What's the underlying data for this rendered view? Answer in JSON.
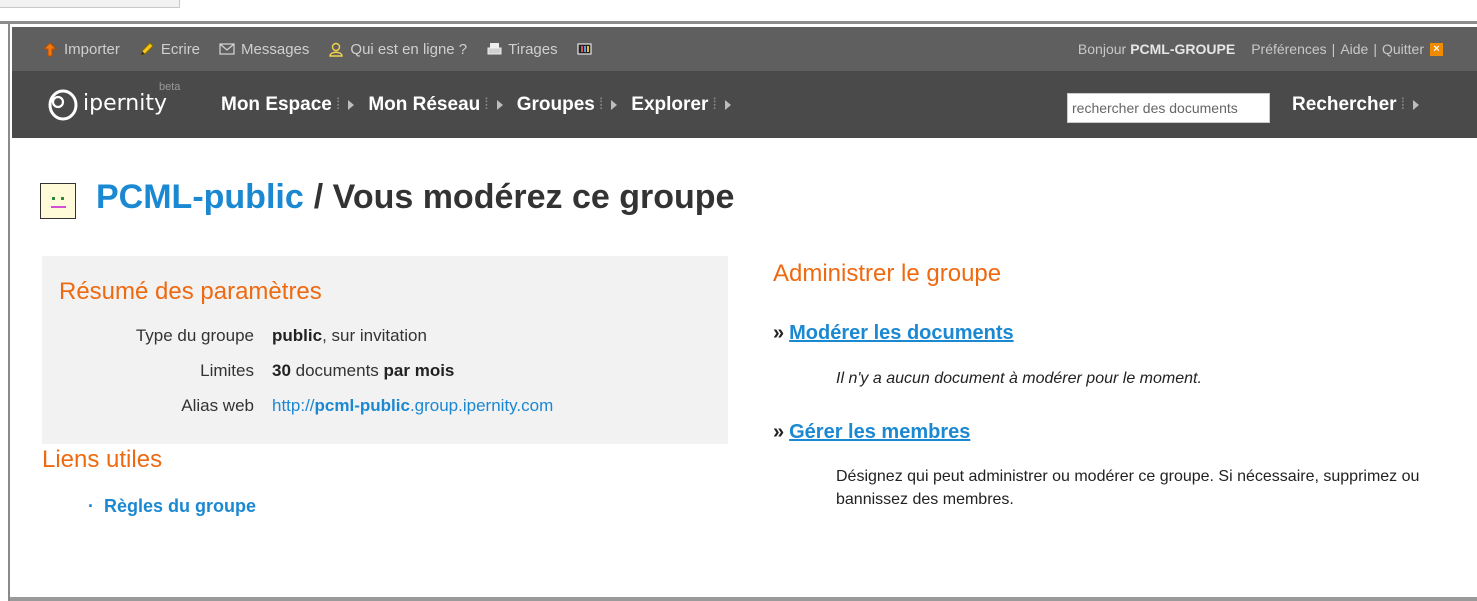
{
  "topbar": {
    "items": [
      {
        "label": "Importer",
        "icon": "upload-arrow-icon"
      },
      {
        "label": "Ecrire",
        "icon": "pencil-icon"
      },
      {
        "label": "Messages",
        "icon": "envelope-icon"
      },
      {
        "label": "Qui est en ligne ?",
        "icon": "user-icon"
      },
      {
        "label": "Tirages",
        "icon": "printer-icon"
      },
      {
        "label": "",
        "icon": "film-icon"
      }
    ],
    "greeting": "Bonjour",
    "username": "PCML-GROUPE",
    "preferences": "Préférences",
    "help": "Aide",
    "quit": "Quitter",
    "separator": "|"
  },
  "navbar": {
    "logo_text": "ipernity",
    "logo_badge": "beta",
    "menu": [
      {
        "label": "Mon Espace"
      },
      {
        "label": "Mon Réseau"
      },
      {
        "label": "Groupes"
      },
      {
        "label": "Explorer"
      }
    ],
    "search_placeholder": "rechercher des documents",
    "search_button": "Rechercher",
    "dotted_separator": "⁞"
  },
  "page": {
    "group_name": "PCML-public",
    "title_suffix": "/ Vous modérez ce groupe"
  },
  "settings": {
    "heading": "Résumé des paramètres",
    "type_label": "Type du groupe",
    "type_value_bold": "public",
    "type_value_rest": ", sur invitation",
    "limits_label": "Limites",
    "limits_count": "30",
    "limits_middle": " documents ",
    "limits_period": "par mois",
    "alias_label": "Alias web",
    "alias_prefix": "http://",
    "alias_bold": "pcml-public",
    "alias_suffix": ".group.ipernity.com"
  },
  "useful_links": {
    "heading": "Liens utiles",
    "bullet": "·",
    "items": [
      {
        "label": "Règles du groupe"
      }
    ]
  },
  "admin": {
    "heading": "Administrer le groupe",
    "marker": "»",
    "actions": [
      {
        "label": "Modérer les documents",
        "description": "Il n'y a aucun document à modérer pour le moment."
      },
      {
        "label": "Gérer les membres",
        "description": "Désignez qui peut administrer ou modérer ce groupe. Si nécessaire, supprimez ou bannissez des membres."
      }
    ]
  },
  "colors": {
    "link_blue": "#1b88d2",
    "heading_orange": "#ee6a11",
    "topbar_bg": "#5f5f5f",
    "navbar_bg": "#4a4a4a",
    "settings_bg": "#f2f2f2"
  }
}
